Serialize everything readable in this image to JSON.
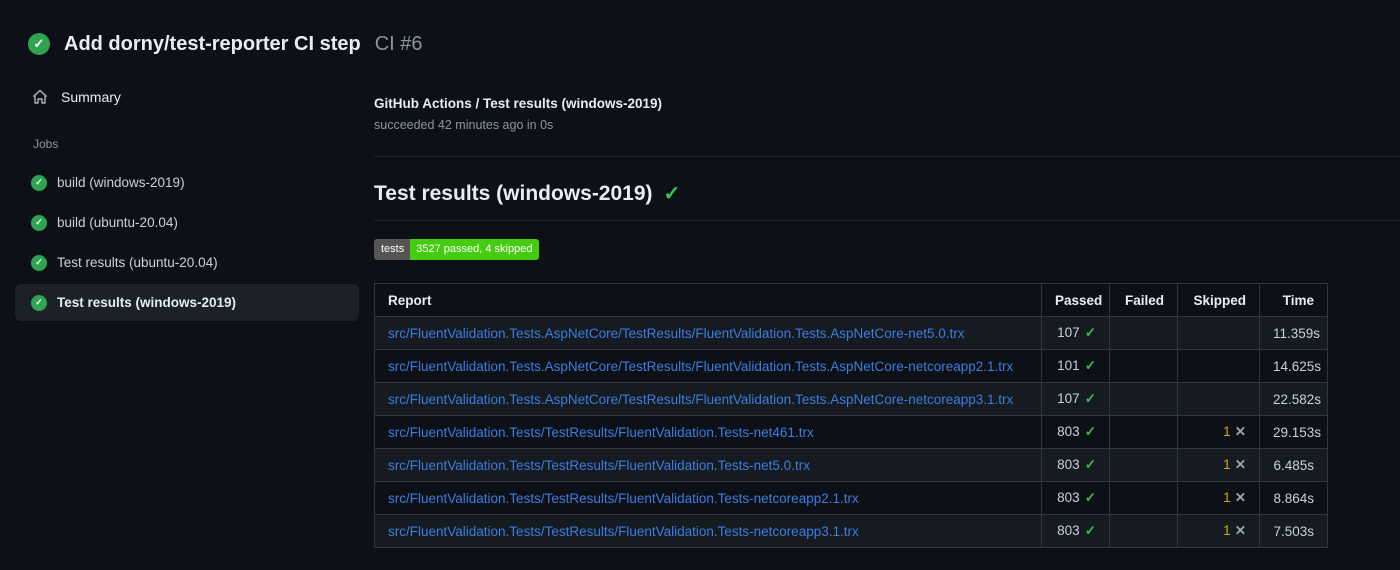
{
  "icons": {
    "check": "✓",
    "x": "✕"
  },
  "header": {
    "title": "Add dorny/test-reporter CI step",
    "run_number": "CI #6"
  },
  "sidebar": {
    "summary_label": "Summary",
    "jobs_label": "Jobs",
    "jobs": [
      {
        "label": "build (windows-2019)",
        "status": "success",
        "selected": false
      },
      {
        "label": "build (ubuntu-20.04)",
        "status": "success",
        "selected": false
      },
      {
        "label": "Test results (ubuntu-20.04)",
        "status": "success",
        "selected": false
      },
      {
        "label": "Test results (windows-2019)",
        "status": "success",
        "selected": true
      }
    ]
  },
  "main": {
    "breadcrumb": "GitHub Actions / Test results (windows-2019)",
    "status_line": "succeeded 42 minutes ago in 0s",
    "section_title": "Test results (windows-2019)",
    "badge": {
      "label": "tests",
      "value": "3527 passed, 4 skipped",
      "label_bg": "#555555",
      "value_bg": "#44cc11"
    },
    "table": {
      "columns": [
        "Report",
        "Passed",
        "Failed",
        "Skipped",
        "Time"
      ],
      "rows": [
        {
          "report": "src/FluentValidation.Tests.AspNetCore/TestResults/FluentValidation.Tests.AspNetCore-net5.0.trx",
          "passed": "107",
          "failed": "",
          "skipped": "",
          "time": "11.359s"
        },
        {
          "report": "src/FluentValidation.Tests.AspNetCore/TestResults/FluentValidation.Tests.AspNetCore-netcoreapp2.1.trx",
          "passed": "101",
          "failed": "",
          "skipped": "",
          "time": "14.625s"
        },
        {
          "report": "src/FluentValidation.Tests.AspNetCore/TestResults/FluentValidation.Tests.AspNetCore-netcoreapp3.1.trx",
          "passed": "107",
          "failed": "",
          "skipped": "",
          "time": "22.582s"
        },
        {
          "report": "src/FluentValidation.Tests/TestResults/FluentValidation.Tests-net461.trx",
          "passed": "803",
          "failed": "",
          "skipped": "1",
          "time": "29.153s"
        },
        {
          "report": "src/FluentValidation.Tests/TestResults/FluentValidation.Tests-net5.0.trx",
          "passed": "803",
          "failed": "",
          "skipped": "1",
          "time": "6.485s"
        },
        {
          "report": "src/FluentValidation.Tests/TestResults/FluentValidation.Tests-netcoreapp2.1.trx",
          "passed": "803",
          "failed": "",
          "skipped": "1",
          "time": "8.864s"
        },
        {
          "report": "src/FluentValidation.Tests/TestResults/FluentValidation.Tests-netcoreapp3.1.trx",
          "passed": "803",
          "failed": "",
          "skipped": "1",
          "time": "7.503s"
        }
      ]
    }
  },
  "colors": {
    "page_bg": "#0d1117",
    "success_circle": "#2ea44f",
    "check_green": "#3fb950",
    "skipped_yellow": "#d3a81e",
    "link_blue": "#3b7ddd",
    "border": "#30363d",
    "row_alt": "#161b22",
    "muted": "#8b949e"
  }
}
